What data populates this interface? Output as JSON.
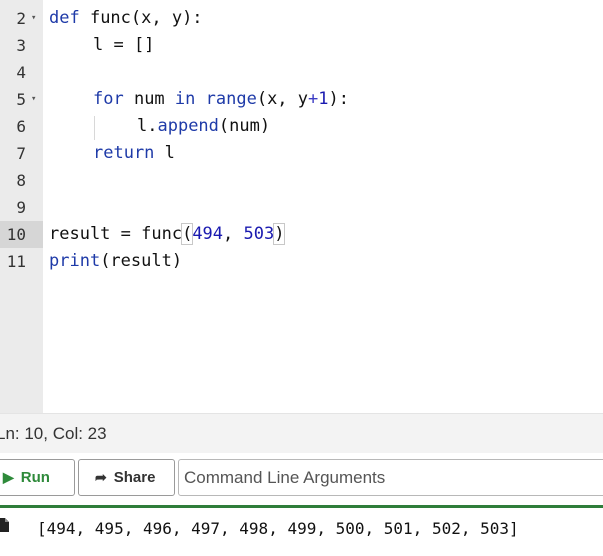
{
  "editor": {
    "lines": [
      {
        "num": "2"
      },
      {
        "num": "3"
      },
      {
        "num": "4"
      },
      {
        "num": "5"
      },
      {
        "num": "6"
      },
      {
        "num": "7"
      },
      {
        "num": "8"
      },
      {
        "num": "9"
      },
      {
        "num": "10"
      },
      {
        "num": "11"
      }
    ],
    "code": {
      "l2_def": "def",
      "l2_rest": " func(x, y):",
      "l3": "l = []",
      "l5_for": "for",
      "l5_num": " num ",
      "l5_in": "in",
      "l5_sp": " ",
      "l5_range": "range",
      "l5_args": "(x, y",
      "l5_plus": "+",
      "l5_one": "1",
      "l5_end": "):",
      "l6_obj": "l.",
      "l6_method": "append",
      "l6_args": "(num)",
      "l7_return": "return",
      "l7_rest": " l",
      "l10_pre": "result = func",
      "l10_open": "(",
      "l10_a": "494",
      "l10_comma": ", ",
      "l10_b": "503",
      "l10_close": ")",
      "l11_print": "print",
      "l11_rest": "(result)"
    }
  },
  "status": {
    "position": "Ln: 10,  Col: 23"
  },
  "toolbar": {
    "run_label": "Run",
    "share_label": "Share",
    "args_placeholder": "Command Line Arguments"
  },
  "output": {
    "text": "[494, 495, 496, 497, 498, 499, 500, 501, 502, 503]"
  },
  "colors": {
    "run_green": "#2e8a3a",
    "divider_green": "#2e7d3a",
    "keyword_blue": "#1e3aa8"
  }
}
